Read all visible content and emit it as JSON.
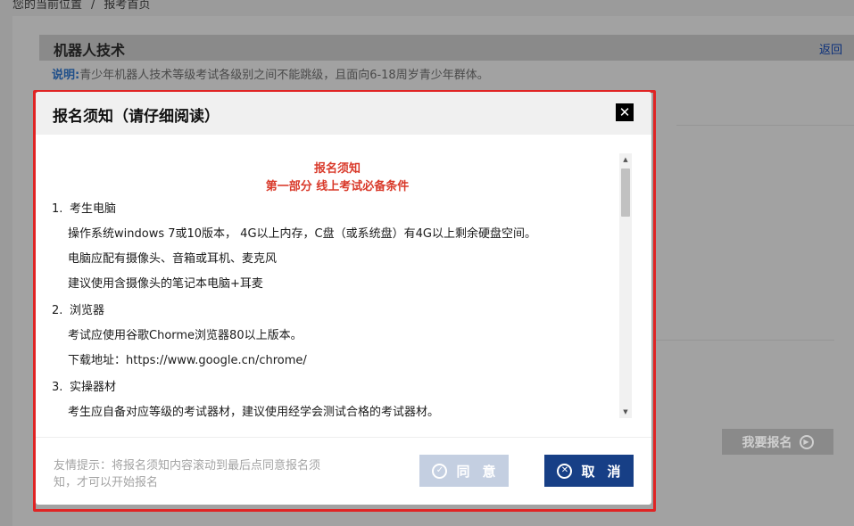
{
  "breadcrumb": {
    "prefix": "您的当前位置",
    "separator": "/",
    "current": "报考首页"
  },
  "section": {
    "title": "机器人技术",
    "back_label": "返回"
  },
  "note": {
    "label": "说明:",
    "text": "青少年机器人技术等级考试各级别之间不能跳级，且面向6-18周岁青少年群体。"
  },
  "enroll_button": {
    "label": "我要报名",
    "icon": "play-circle-icon"
  },
  "modal": {
    "title": "报名须知（请仔细阅读）",
    "close_icon": "close-icon",
    "heading": "报名须知",
    "subheading": "第一部分 线上考试必备条件",
    "sections": [
      {
        "num": "1.",
        "title": "考生电脑",
        "lines": [
          "操作系统windows 7或10版本， 4G以上内存，C盘（或系统盘）有4G以上剩余硬盘空间。",
          "电脑应配有摄像头、音箱或耳机、麦克风",
          "建议使用含摄像头的笔记本电脑+耳麦"
        ]
      },
      {
        "num": "2.",
        "title": "浏览器",
        "lines": [
          "考试应使用谷歌Chorme浏览器80以上版本。",
          "下载地址：https://www.google.cn/chrome/"
        ]
      },
      {
        "num": "3.",
        "title": "实操器材",
        "lines": [
          "考生应自备对应等级的考试器材，建议使用经学会测试合格的考试器材。"
        ]
      }
    ],
    "tip": "友情提示：将报名须知内容滚动到最后点同意报名须知，才可以开始报名",
    "agree_label": "同意",
    "cancel_label": "取消",
    "agree_icon": "check-circle-icon",
    "cancel_icon": "x-circle-icon"
  },
  "colors": {
    "overlay": "#9b9b9b",
    "primary": "#173f86",
    "notice_red": "#d93a2b",
    "highlight_frame": "#e02424"
  }
}
